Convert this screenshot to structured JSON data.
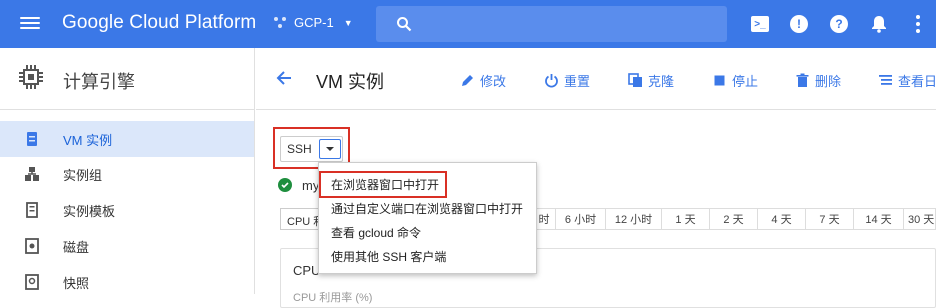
{
  "topbar": {
    "brand": "Google Cloud Platform",
    "project": "GCP-1",
    "colors": {
      "bar": "#3b78e7",
      "search": "#5a8ded"
    }
  },
  "sidebar": {
    "title": "计算引擎",
    "items": [
      {
        "label": "VM 实例",
        "icon": "vm-instance-icon",
        "active": true
      },
      {
        "label": "实例组",
        "icon": "instance-group-icon"
      },
      {
        "label": "实例模板",
        "icon": "instance-template-icon"
      },
      {
        "label": "磁盘",
        "icon": "disk-icon"
      },
      {
        "label": "快照",
        "icon": "snapshot-icon"
      }
    ]
  },
  "header": {
    "title": "VM 实例",
    "actions": [
      {
        "label": "修改",
        "icon": "pencil-icon"
      },
      {
        "label": "重置",
        "icon": "power-icon"
      },
      {
        "label": "克隆",
        "icon": "clone-icon"
      },
      {
        "label": "停止",
        "icon": "stop-icon"
      },
      {
        "label": "删除",
        "icon": "trash-icon"
      },
      {
        "label": "查看日",
        "icon": "logs-icon"
      }
    ]
  },
  "ssh": {
    "label": "SSH"
  },
  "instance": {
    "name": "my"
  },
  "metric_select": "CPU 利",
  "time_ranges": [
    "时",
    "6 小时",
    "12 小时",
    "1 天",
    "2 天",
    "4 天",
    "7 天",
    "14 天",
    "30 天"
  ],
  "card": {
    "title": "CPU",
    "subtitle": "CPU 利用率 (%)"
  },
  "menu": {
    "items": [
      "在浏览器窗口中打开",
      "通过自定义端口在浏览器窗口中打开",
      "查看 gcloud 命令",
      "使用其他 SSH 客户端"
    ]
  }
}
